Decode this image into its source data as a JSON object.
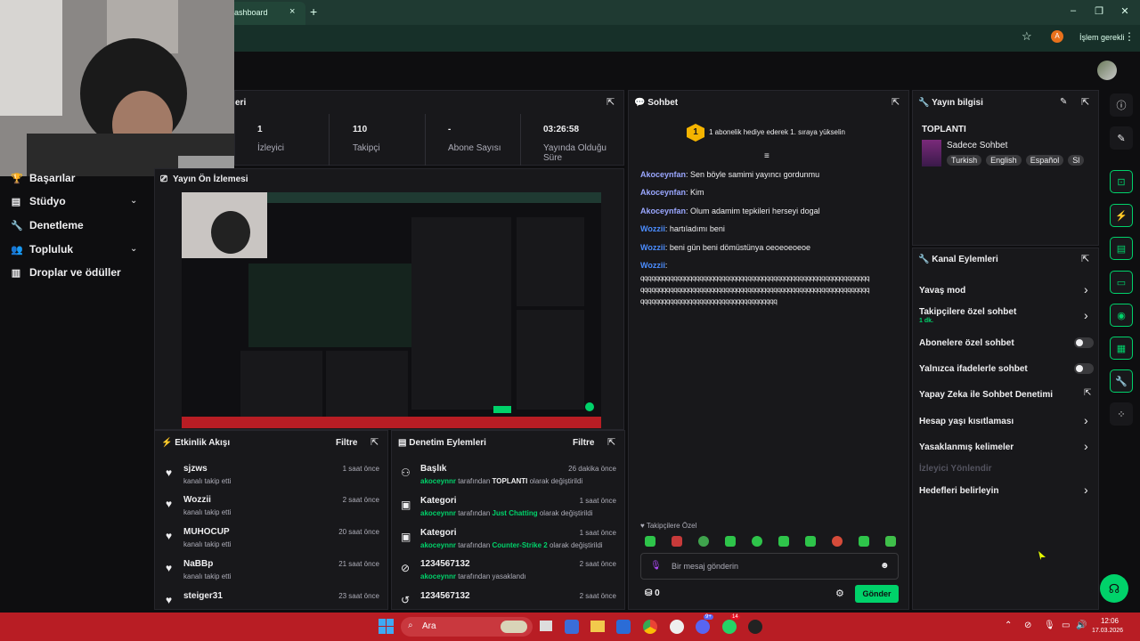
{
  "browser": {
    "tab_title": "ashboard",
    "tab_close": "×",
    "new_tab": "+",
    "profile_initial": "A",
    "action_required": "İşlem gerekli",
    "win_min": "–",
    "win_max": "❐",
    "win_close": "✕"
  },
  "nav": {
    "items": [
      {
        "label": "Başarılar",
        "icon": "trophy-icon"
      },
      {
        "label": "Stüdyo",
        "icon": "studio-icon"
      },
      {
        "label": "Denetleme",
        "icon": "wrench-icon"
      },
      {
        "label": "Topluluk",
        "icon": "community-icon"
      },
      {
        "label": "Droplar ve ödüller",
        "icon": "drops-icon"
      }
    ]
  },
  "stats": {
    "header_fragment": "eri",
    "items": [
      {
        "value": "1",
        "label": "İzleyici"
      },
      {
        "value": "110",
        "label": "Takipçi"
      },
      {
        "value": "-",
        "label": "Abone Sayısı"
      },
      {
        "value": "03:26:58",
        "label": "Yayında Olduğu Süre"
      }
    ]
  },
  "preview": {
    "title": "Yayın Ön İzlemesi"
  },
  "activity": {
    "title": "Etkinlik Akışı",
    "filter": "Filtre",
    "items": [
      {
        "name": "sjzws",
        "sub": "kanalı takip etti",
        "time": "1 saat önce"
      },
      {
        "name": "Wozzii",
        "sub": "kanalı takip etti",
        "time": "2 saat önce"
      },
      {
        "name": "MUHOCUP",
        "sub": "kanalı takip etti",
        "time": "20 saat önce"
      },
      {
        "name": "NaBBp",
        "sub": "kanalı takip etti",
        "time": "21 saat önce"
      },
      {
        "name": "steiger31",
        "sub": "",
        "time": "23 saat önce"
      }
    ]
  },
  "moderation": {
    "title": "Denetim Eylemleri",
    "filter": "Filtre",
    "items": [
      {
        "title": "Başlık",
        "time": "26 dakika önce",
        "actor": "akoceynnr",
        "mid": " tarafından ",
        "target": "TOPLANTI",
        "end": " olarak değiştirildi",
        "target_green": false
      },
      {
        "title": "Kategori",
        "time": "1 saat önce",
        "actor": "akoceynnr",
        "mid": " tarafından ",
        "target": "Just Chatting",
        "end": " olarak değiştirildi",
        "target_green": true
      },
      {
        "title": "Kategori",
        "time": "1 saat önce",
        "actor": "akoceynnr",
        "mid": " tarafından ",
        "target": "Counter-Strike 2",
        "end": " olarak değiştirildi",
        "target_green": true
      },
      {
        "title": "1234567132",
        "time": "2 saat önce",
        "actor": "akoceynnr",
        "mid": " tarafından yasaklandı",
        "target": "",
        "end": "",
        "target_green": false
      },
      {
        "title": "1234567132",
        "time": "2 saat önce",
        "actor": "",
        "mid": "",
        "target": "",
        "end": "",
        "target_green": false
      }
    ]
  },
  "chat": {
    "title": "Sohbet",
    "gift_badge": "1",
    "gift_text": "1 abonelik hediye ederek 1. sıraya yükselin",
    "messages": [
      {
        "user": "Akoceynfan",
        "text": ": Sen böyle samimi yayıncı gordunmu",
        "color": "#9aa7ff"
      },
      {
        "user": "Akoceynfan",
        "text": ": Kim",
        "color": "#9aa7ff"
      },
      {
        "user": "Akoceynfan",
        "text": ": Olum adamim tepkileri herseyi dogal",
        "color": "#9aa7ff"
      },
      {
        "user": "Wozzii",
        "text": ": hartıladımı beni",
        "color": "#4b8dff"
      },
      {
        "user": "Wozzii",
        "text": ": beni gün beni dömüstünya oeoeoeoeoe",
        "color": "#4b8dff"
      },
      {
        "user": "Wozzii",
        "text": ":",
        "color": "#4b8dff"
      }
    ],
    "long_text_1": "qqqqqqqqqqqqqqqqqqqqqqqqqqqqqqqqqqqqqqqqqqqqqqqqqqqqqqqqqqqqqq",
    "long_text_2": "qqqqqqqqqqqqqqqqqqqqqqqqqqqqqqqqqqqqqqqqqqqqqqqqqqqqqqqqqqqqqq",
    "long_text_3": "qqqqqqqqqqqqqqqqqqqqqqqqqqqqqqqqqqqqq",
    "followers_only": "Takipçilere Özel",
    "placeholder": "Bir mesaj gönderin",
    "points": "0",
    "send": "Gönder"
  },
  "stream_info": {
    "title": "Yayın bilgisi",
    "stream_title": "TOPLANTI",
    "category": "Sadece Sohbet",
    "tags": [
      "Turkish",
      "English",
      "Español",
      "Sl"
    ]
  },
  "channel_actions": {
    "title": "Kanal Eylemleri",
    "slow": "Yavaş mod",
    "followers": "Takipçilere özel sohbet",
    "followers_sub": "1 dk.",
    "subs": "Abonelere özel sohbet",
    "emotes": "Yalnızca ifadelerle sohbet",
    "ai": "Yapay Zeka ile Sohbet Denetimi",
    "age": "Hesap yaşı kısıtlaması",
    "banned": "Yasaklanmış kelimeler",
    "viewer": "İzleyici Yönlendir",
    "goals": "Hedefleri belirleyin"
  },
  "taskbar": {
    "search": "Ara",
    "time": "12:06",
    "date": "17.03.2026",
    "badge1": "9+",
    "badge2": "14"
  },
  "colors": {
    "accent": "#00d26a",
    "panel": "#18181b",
    "bg": "#0e0e10",
    "taskbar": "#b81d24"
  }
}
